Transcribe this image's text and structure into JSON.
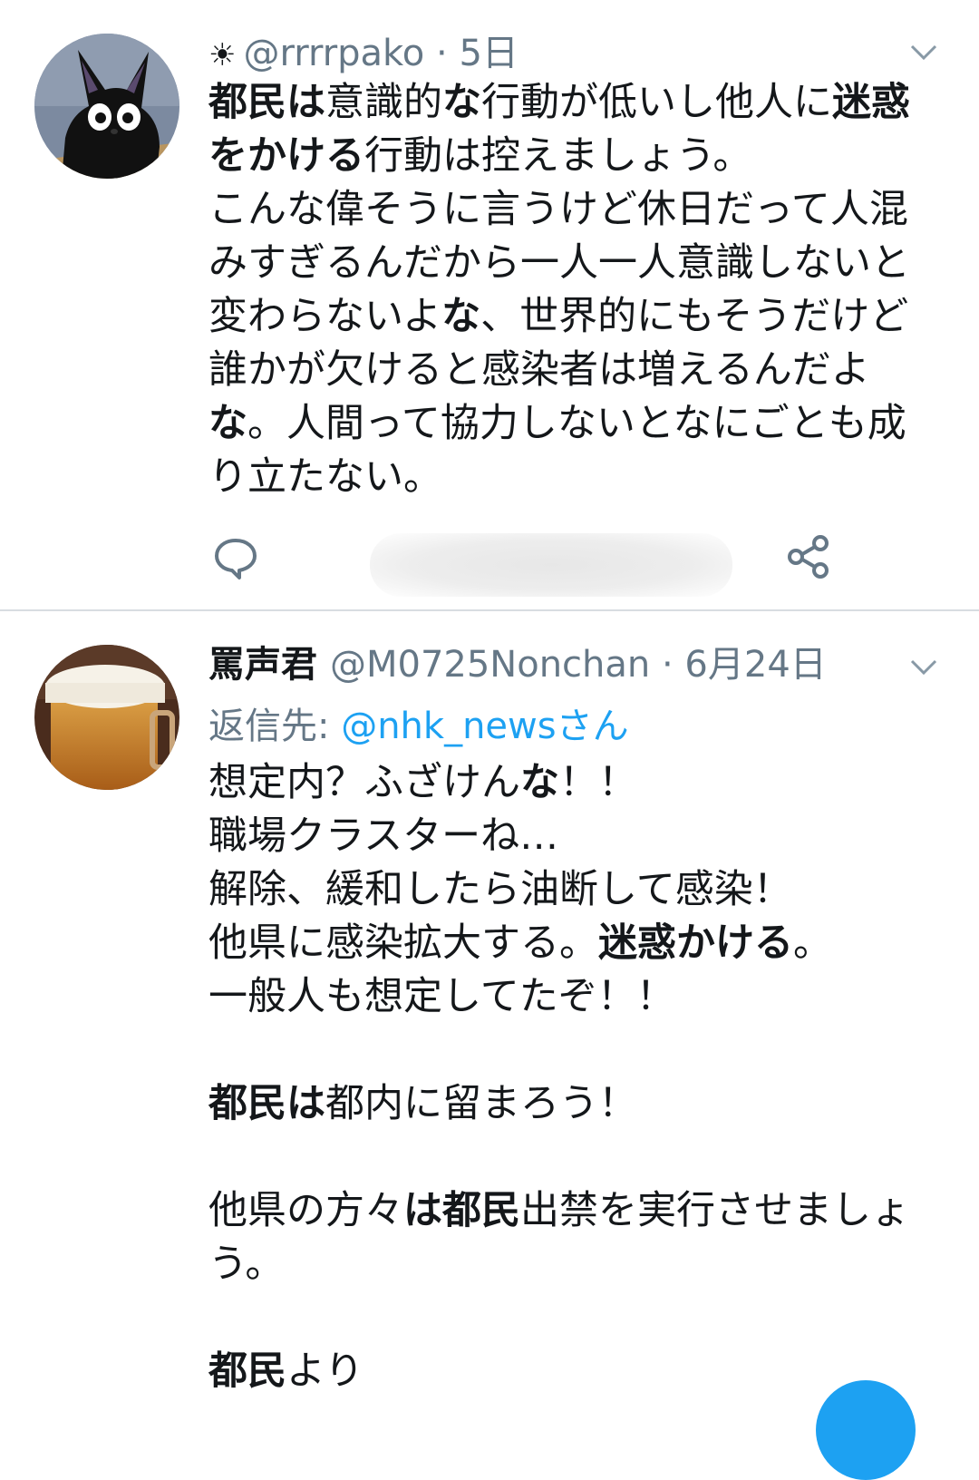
{
  "tweets": [
    {
      "status_icon": "sun-icon",
      "name": "",
      "handle": "@rrrrpako",
      "time": "5日",
      "lines": [
        [
          [
            "都民は",
            true
          ],
          [
            "意識的",
            false
          ],
          [
            "な",
            true
          ],
          [
            "行動が低いし他人に",
            false
          ],
          [
            "迷惑",
            true
          ]
        ],
        [
          [
            "をかける",
            true
          ],
          [
            "行動は控えましょう。",
            false
          ]
        ],
        [
          [
            "こんな偉そうに言うけど休日だって人混",
            false
          ]
        ],
        [
          [
            "みすぎるんだから一人一人意識しないと",
            false
          ]
        ],
        [
          [
            "変わらないよ",
            false
          ],
          [
            "な",
            true
          ],
          [
            "、世界的にもそうだけど",
            false
          ]
        ],
        [
          [
            "誰かが欠けると感染者は増えるんだよ",
            false
          ]
        ],
        [
          [
            "な",
            true
          ],
          [
            "。人間って協力しないとなにごとも成",
            false
          ]
        ],
        [
          [
            "り立たない。",
            false
          ]
        ]
      ],
      "actions": [
        "reply-icon",
        "share-icon"
      ]
    },
    {
      "name": "罵声君",
      "handle": "@M0725Nonchan",
      "time": "6月24日",
      "reply_prefix": "返信先: ",
      "reply_mention": "@nhk_newsさん",
      "lines": [
        [
          [
            "想定内？ふざけん",
            false
          ],
          [
            "な",
            true
          ],
          [
            "！！",
            false
          ]
        ],
        [
          [
            "職場クラスターね…",
            false
          ]
        ],
        [
          [
            "解除、緩和したら油断して感染！",
            false
          ]
        ],
        [
          [
            "他県に感染拡大する。",
            false
          ],
          [
            "迷惑かける",
            true
          ],
          [
            "。",
            false
          ]
        ],
        [
          [
            "一般人も想定してたぞ！！",
            false
          ]
        ],
        [],
        [
          [
            "都民は",
            true
          ],
          [
            "都内に留まろう！",
            false
          ]
        ],
        [],
        [
          [
            "他県の方々",
            false
          ],
          [
            "は都民",
            true
          ],
          [
            "出禁を実行させましょ",
            false
          ]
        ],
        [
          [
            "う。",
            false
          ]
        ],
        [],
        [
          [
            "都民",
            true
          ],
          [
            "より",
            false
          ]
        ]
      ]
    }
  ],
  "dot": " · ",
  "colors": {
    "accent": "#1da1f2",
    "muted": "#657786",
    "text": "#14171a"
  }
}
